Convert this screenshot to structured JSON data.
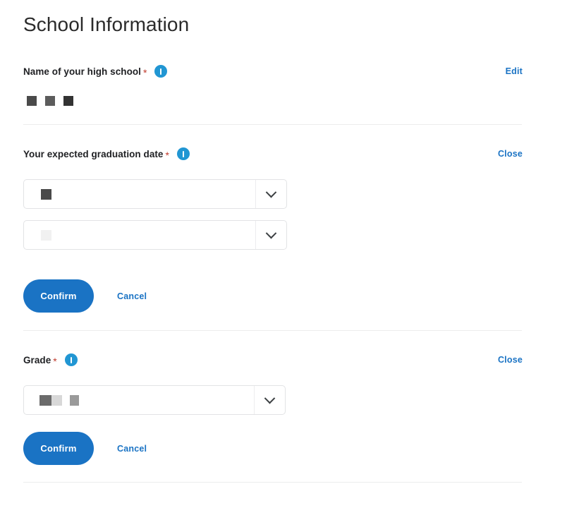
{
  "page": {
    "title": "School Information",
    "background_color": "#ffffff",
    "accent_color": "#1a73c4",
    "info_icon_color": "#2196d3",
    "required_marker_color": "#c0392b",
    "divider_color": "#eceded"
  },
  "sections": [
    {
      "id": "school-name",
      "label": "Name of your high school",
      "required_marker": "*",
      "info_icon": "info-circle-icon",
      "action_label": "Edit",
      "value_redacted": true,
      "redaction_blocks": [
        {
          "width": 14,
          "height": 14,
          "color": "#4a4a4a",
          "gap": 12
        },
        {
          "width": 14,
          "height": 14,
          "color": "#5c5c5c",
          "gap": 12
        },
        {
          "width": 14,
          "height": 14,
          "color": "#333333",
          "gap": 0
        }
      ]
    },
    {
      "id": "graduation-date",
      "label": "Your expected graduation date",
      "required_marker": "*",
      "info_icon": "info-circle-icon",
      "action_label": "Close",
      "selects": [
        {
          "id": "graduation-month-select",
          "state": "filled",
          "arrow_icon": "chevron-down-icon",
          "value_redacted": true,
          "redaction_blocks": [
            {
              "width": 15,
              "height": 15,
              "color": "#494949",
              "gap": 0
            }
          ]
        },
        {
          "id": "graduation-year-select",
          "state": "placeholder",
          "arrow_icon": "chevron-down-icon",
          "value_redacted": true,
          "redaction_blocks": [
            {
              "width": 15,
              "height": 15,
              "color": "#f1f1f1",
              "gap": 0
            }
          ]
        }
      ],
      "confirm_label": "Confirm",
      "cancel_label": "Cancel"
    },
    {
      "id": "grade",
      "label": "Grade",
      "required_marker": "*",
      "info_icon": "info-circle-icon",
      "action_label": "Close",
      "selects": [
        {
          "id": "grade-select",
          "state": "filled",
          "arrow_icon": "chevron-down-icon",
          "value_redacted": true,
          "redaction_blocks": [
            {
              "width": 17,
              "height": 15,
              "color": "#6b6b6b",
              "gap": 0
            },
            {
              "width": 15,
              "height": 15,
              "color": "#d8d8d8",
              "gap": 11
            },
            {
              "width": 13,
              "height": 15,
              "color": "#9a9a9a",
              "gap": 0
            }
          ]
        }
      ],
      "confirm_label": "Confirm",
      "cancel_label": "Cancel"
    }
  ]
}
